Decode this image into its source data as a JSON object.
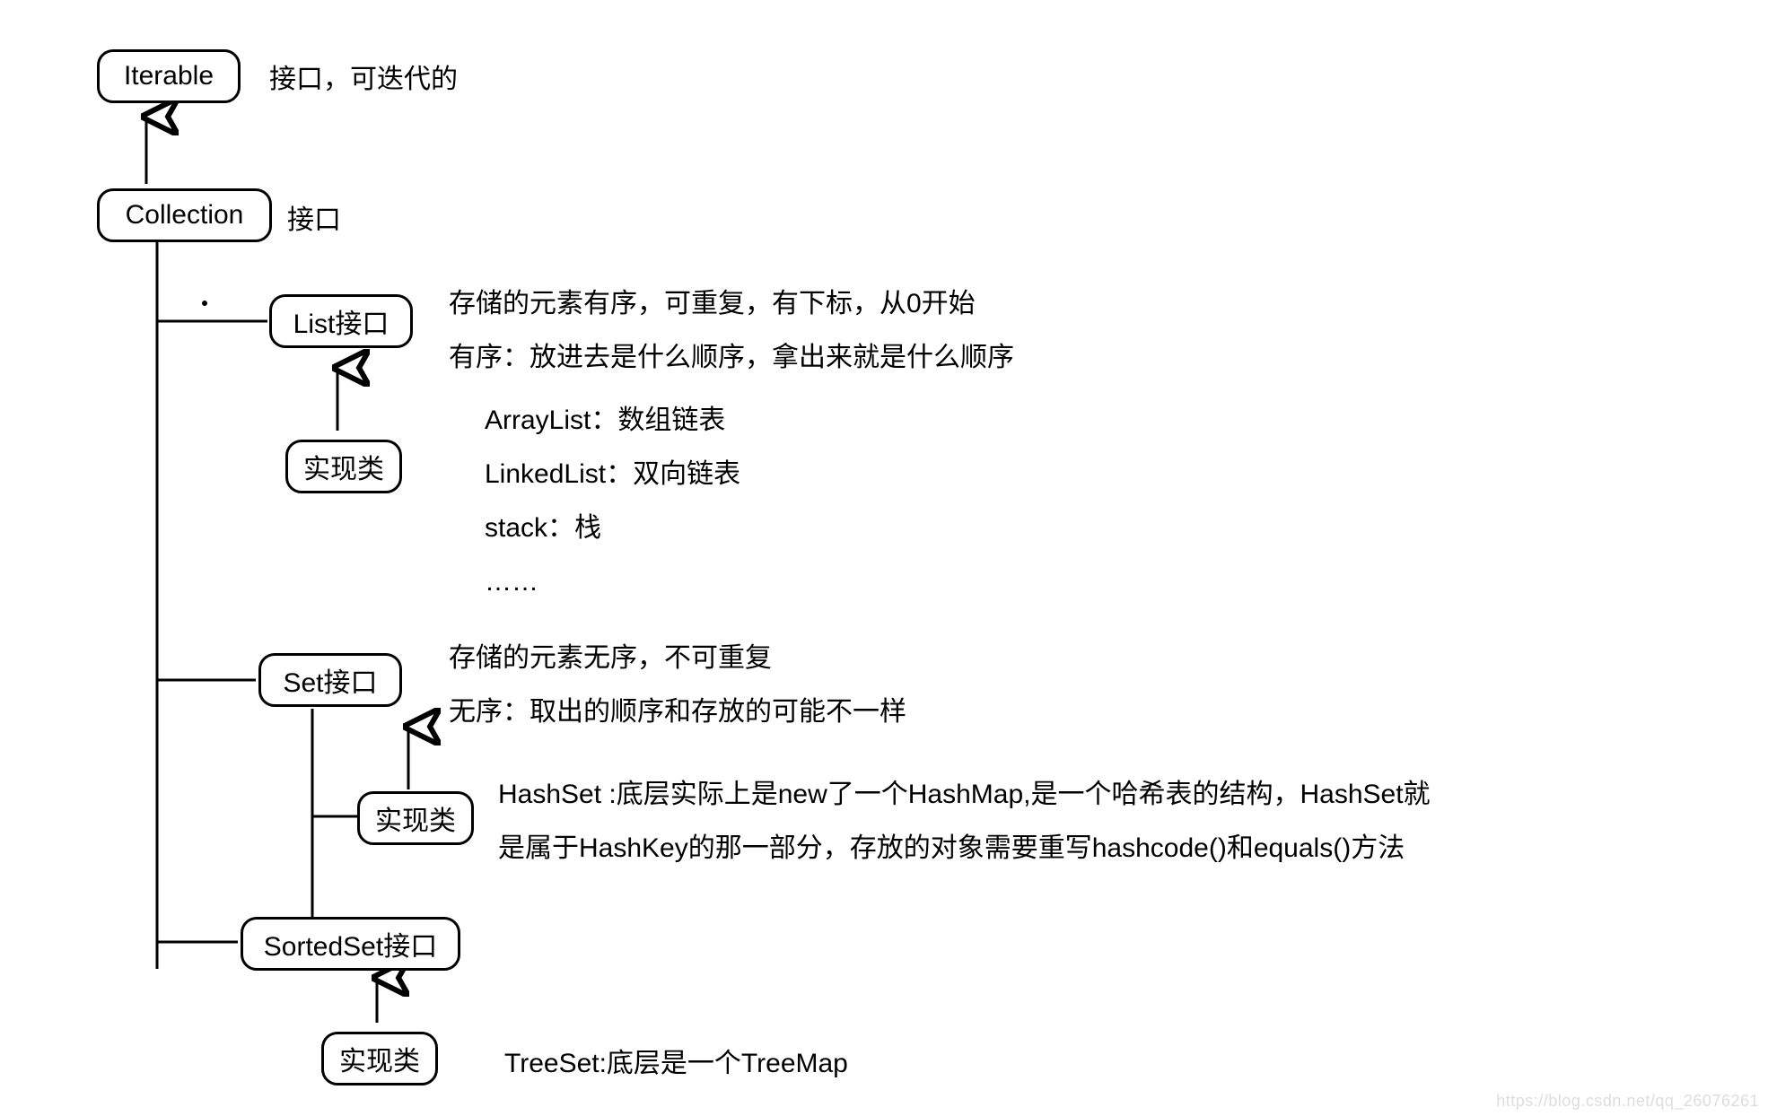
{
  "nodes": {
    "iterable": "Iterable",
    "collection": "Collection",
    "list": "List接口",
    "list_impl": "实现类",
    "set": "Set接口",
    "set_impl": "实现类",
    "sortedset": "SortedSet接口",
    "sortedset_impl": "实现类"
  },
  "labels": {
    "iterable_desc": "接口，可迭代的",
    "collection_desc": "接口",
    "list_desc_1": "存储的元素有序，可重复，有下标，从0开始",
    "list_desc_2": "有序：放进去是什么顺序，拿出来就是什么顺序",
    "list_impl_1": "ArrayList：数组链表",
    "list_impl_2": "LinkedList：双向链表",
    "list_impl_3": "stack：栈",
    "list_impl_4": "……",
    "set_desc_1": "存储的元素无序，不可重复",
    "set_desc_2": "无序：取出的顺序和存放的可能不一样",
    "set_impl_1": "HashSet :底层实际上是new了一个HashMap,是一个哈希表的结构，HashSet就",
    "set_impl_2": "是属于HashKey的那一部分，存放的对象需要重写hashcode()和equals()方法",
    "sortedset_impl_1": "TreeSet:底层是一个TreeMap"
  },
  "watermark": "https://blog.csdn.net/qq_26076261"
}
